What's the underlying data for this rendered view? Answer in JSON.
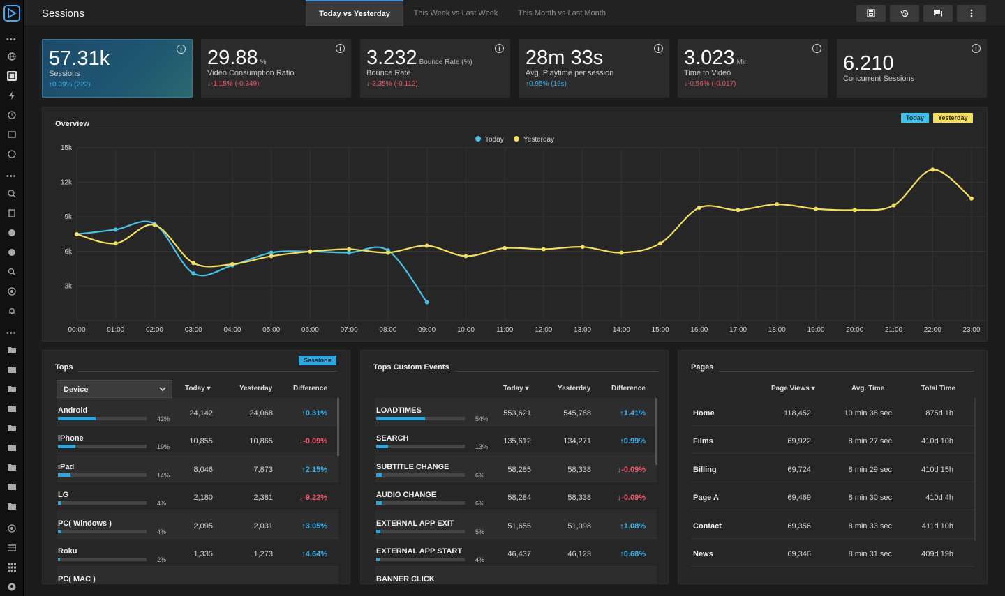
{
  "header": {
    "title": "Sessions",
    "tabs": [
      {
        "label": "Today vs Yesterday",
        "active": true
      },
      {
        "label": "This Week vs Last Week",
        "active": false
      },
      {
        "label": "This Month vs Last Month",
        "active": false
      }
    ],
    "buttons": [
      "save-icon",
      "history-icon",
      "comments-icon",
      "more-vertical-icon"
    ]
  },
  "kpis": [
    {
      "value": "57.31k",
      "unit": "",
      "label": "Sessions",
      "delta": "0.39% (222)",
      "trend": "up"
    },
    {
      "value": "29.88",
      "unit": "%",
      "label": "Video Consumption Ratio",
      "delta": "-1.15% (-0.349)",
      "trend": "down"
    },
    {
      "value": "3.232",
      "unit": "Bounce Rate (%)",
      "label": "Bounce Rate",
      "delta": "-3.35% (-0.112)",
      "trend": "down"
    },
    {
      "value": "28m 33s",
      "unit": "",
      "label": "Avg. Playtime per session",
      "delta": "0.95% (16s)",
      "trend": "up"
    },
    {
      "value": "3.023",
      "unit": "Min",
      "label": "Time to Video",
      "delta": "-0.56% (-0.017)",
      "trend": "down"
    },
    {
      "value": "6.210",
      "unit": "",
      "label": "Concurrent Sessions",
      "delta": "",
      "trend": ""
    }
  ],
  "overview": {
    "title": "Overview",
    "badge_today": "Today",
    "badge_yesterday": "Yesterday",
    "legend_today": "Today",
    "legend_yesterday": "Yesterday"
  },
  "chart_data": {
    "type": "line",
    "x": [
      "00:00",
      "01:00",
      "02:00",
      "03:00",
      "04:00",
      "05:00",
      "06:00",
      "07:00",
      "08:00",
      "09:00",
      "10:00",
      "11:00",
      "12:00",
      "13:00",
      "14:00",
      "15:00",
      "16:00",
      "17:00",
      "18:00",
      "19:00",
      "20:00",
      "21:00",
      "22:00",
      "23:00"
    ],
    "series": [
      {
        "name": "Today",
        "color": "#45c2ea",
        "values": [
          7500,
          7900,
          8400,
          4100,
          4800,
          5900,
          6000,
          5900,
          6100,
          1600
        ]
      },
      {
        "name": "Yesterday",
        "color": "#f4df5c",
        "values": [
          7500,
          6700,
          8300,
          5000,
          4900,
          5600,
          6000,
          6200,
          5900,
          6500,
          5600,
          6300,
          6200,
          6400,
          5900,
          6700,
          9800,
          9600,
          10100,
          9700,
          9600,
          10000,
          13100,
          10600
        ]
      }
    ],
    "yticks": [
      "3k",
      "6k",
      "9k",
      "12k",
      "15k"
    ],
    "ylim": [
      0,
      15000
    ],
    "grid": true,
    "legend": "top-center"
  },
  "colors": {
    "accent": "#2aa7e0",
    "up": "#3ab0ea",
    "down": "#f0566b",
    "today": "#45c2ea",
    "yesterday": "#f4df5c"
  },
  "tops": {
    "title": "Tops",
    "badge": "Sessions",
    "dropdown": "Device",
    "headers": {
      "today": "Today",
      "yesterday": "Yesterday",
      "difference": "Difference"
    },
    "rows": [
      {
        "name": "Android",
        "pct": "42%",
        "share": 0.42,
        "today": "24,142",
        "yesterday": "24,068",
        "diff": "0.31%",
        "trend": "up"
      },
      {
        "name": "iPhone",
        "pct": "19%",
        "share": 0.19,
        "today": "10,855",
        "yesterday": "10,865",
        "diff": "-0.09%",
        "trend": "down"
      },
      {
        "name": "iPad",
        "pct": "14%",
        "share": 0.14,
        "today": "8,046",
        "yesterday": "7,873",
        "diff": "2.15%",
        "trend": "up"
      },
      {
        "name": "LG",
        "pct": "4%",
        "share": 0.04,
        "today": "2,180",
        "yesterday": "2,381",
        "diff": "-9.22%",
        "trend": "down"
      },
      {
        "name": "PC( Windows )",
        "pct": "4%",
        "share": 0.04,
        "today": "2,095",
        "yesterday": "2,031",
        "diff": "3.05%",
        "trend": "up"
      },
      {
        "name": "Roku",
        "pct": "2%",
        "share": 0.02,
        "today": "1,335",
        "yesterday": "1,273",
        "diff": "4.64%",
        "trend": "up"
      },
      {
        "name": "PC( MAC )",
        "pct": "",
        "share": 0,
        "today": "",
        "yesterday": "",
        "diff": "",
        "trend": ""
      }
    ]
  },
  "custom_events": {
    "title": "Tops Custom Events",
    "headers": {
      "today": "Today",
      "yesterday": "Yesterday",
      "difference": "Difference"
    },
    "rows": [
      {
        "name": "LOADTIMES",
        "pct": "54%",
        "share": 0.54,
        "today": "553,621",
        "yesterday": "545,788",
        "diff": "1.41%",
        "trend": "up"
      },
      {
        "name": "SEARCH",
        "pct": "13%",
        "share": 0.13,
        "today": "135,612",
        "yesterday": "134,271",
        "diff": "0.99%",
        "trend": "up"
      },
      {
        "name": "SUBTITLE CHANGE",
        "pct": "6%",
        "share": 0.06,
        "today": "58,285",
        "yesterday": "58,338",
        "diff": "-0.09%",
        "trend": "down"
      },
      {
        "name": "AUDIO CHANGE",
        "pct": "6%",
        "share": 0.06,
        "today": "58,284",
        "yesterday": "58,338",
        "diff": "-0.09%",
        "trend": "down"
      },
      {
        "name": "EXTERNAL APP EXIT",
        "pct": "5%",
        "share": 0.05,
        "today": "51,655",
        "yesterday": "51,098",
        "diff": "1.08%",
        "trend": "up"
      },
      {
        "name": "EXTERNAL APP START",
        "pct": "4%",
        "share": 0.04,
        "today": "46,437",
        "yesterday": "46,123",
        "diff": "0.68%",
        "trend": "up"
      },
      {
        "name": "BANNER CLICK",
        "pct": "",
        "share": 0,
        "today": "",
        "yesterday": "",
        "diff": "",
        "trend": ""
      }
    ]
  },
  "pages": {
    "title": "Pages",
    "headers": {
      "views": "Page Views",
      "avg": "Avg. Time",
      "total": "Total Time"
    },
    "rows": [
      {
        "name": "Home",
        "views": "118,452",
        "avg": "10 min 38 sec",
        "total": "875d 1h"
      },
      {
        "name": "Films",
        "views": "69,922",
        "avg": "8 min 27 sec",
        "total": "410d 10h"
      },
      {
        "name": "Billing",
        "views": "69,724",
        "avg": "8 min 29 sec",
        "total": "410d 15h"
      },
      {
        "name": "Page A",
        "views": "69,469",
        "avg": "8 min 30 sec",
        "total": "410d 4h"
      },
      {
        "name": "Contact",
        "views": "69,356",
        "avg": "8 min 33 sec",
        "total": "411d 10h"
      },
      {
        "name": "News",
        "views": "69,346",
        "avg": "8 min 31 sec",
        "total": "409d 19h"
      }
    ]
  }
}
